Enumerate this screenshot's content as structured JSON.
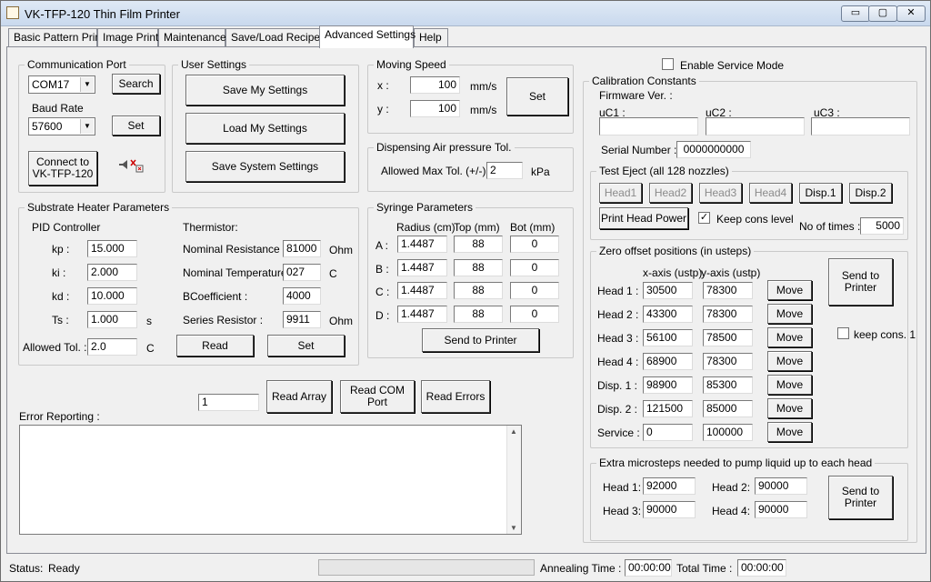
{
  "window": {
    "title": "VK-TFP-120 Thin Film Printer",
    "minimize": "▭",
    "maximize": "▢",
    "close": "✕"
  },
  "tabs": [
    "Basic Pattern Print",
    "Image Print",
    "Maintenance",
    "Save/Load Recipe",
    "Advanced Settings",
    "Help"
  ],
  "comm": {
    "title": "Communication Port",
    "port": "COM17",
    "search": "Search",
    "baud_label": "Baud Rate",
    "baud": "57600",
    "set": "Set",
    "connect": "Connect to VK-TFP-120"
  },
  "user": {
    "title": "User Settings",
    "save_my": "Save My Settings",
    "load_my": "Load My Settings",
    "save_system": "Save System Settings"
  },
  "speed": {
    "title": "Moving Speed",
    "x_label": "x :",
    "x": "100",
    "y_label": "y :",
    "y": "100",
    "unit": "mm/s",
    "set": "Set"
  },
  "air": {
    "title": "Dispensing Air pressure Tol.",
    "label": "Allowed Max Tol. (+/-) :",
    "value": "2",
    "unit": "kPa"
  },
  "heater": {
    "title": "Substrate Heater Parameters",
    "pid": "PID Controller",
    "kp_l": "kp :",
    "kp": "15.000",
    "ki_l": "ki :",
    "ki": "2.000",
    "kd_l": "kd :",
    "kd": "10.000",
    "ts_l": "Ts :",
    "ts": "1.000",
    "ts_u": "s",
    "therm": "Thermistor:",
    "nr_l": "Nominal Resistance :",
    "nr": "81000",
    "nr_u": "Ohm",
    "nt_l": "Nominal Temperature :",
    "nt": "027",
    "nt_u": "C",
    "bc_l": "BCoefficient :",
    "bc": "4000",
    "sr_l": "Series Resistor :",
    "sr": "9911",
    "sr_u": "Ohm",
    "tol_l": "Allowed Tol. :",
    "tol": "2.0",
    "tol_u": "C",
    "read": "Read",
    "set": "Set"
  },
  "syringe": {
    "title": "Syringe Parameters",
    "h_radius": "Radius (cm)",
    "h_top": "Top (mm)",
    "h_bot": "Bot (mm)",
    "rows": [
      {
        "l": "A :",
        "r": "1.4487",
        "t": "88",
        "b": "0"
      },
      {
        "l": "B :",
        "r": "1.4487",
        "t": "88",
        "b": "0"
      },
      {
        "l": "C :",
        "r": "1.4487",
        "t": "88",
        "b": "0"
      },
      {
        "l": "D :",
        "r": "1.4487",
        "t": "88",
        "b": "0"
      }
    ],
    "send": "Send to Printer"
  },
  "misc": {
    "array_idx": "1",
    "read_array": "Read Array",
    "read_com": "Read COM Port",
    "read_errors": "Read Errors",
    "err_label": "Error Reporting :",
    "err_text": ""
  },
  "service": {
    "label": "Enable Service Mode"
  },
  "calib": {
    "title": "Calibration Constants",
    "fw": "Firmware Ver. :",
    "uc1": "uC1 :",
    "uc2": "uC2 :",
    "uc3": "uC3 :",
    "sn_l": "Serial Number :",
    "sn": "0000000000"
  },
  "eject": {
    "title": "Test Eject (all 128 nozzles)",
    "buttons": [
      "Head1",
      "Head2",
      "Head3",
      "Head4",
      "Disp.1",
      "Disp.2"
    ],
    "power": "Print Head Power",
    "keep": "Keep cons level",
    "keep_checked": "✓",
    "times_l": "No of times :",
    "times": "5000"
  },
  "zero": {
    "title": "Zero offset positions (in usteps)",
    "hx": "x-axis (ustp)",
    "hy": "y-axis (ustp)",
    "move": "Move",
    "rows": [
      {
        "l": "Head 1 :",
        "x": "30500",
        "y": "78300"
      },
      {
        "l": "Head 2 :",
        "x": "43300",
        "y": "78300"
      },
      {
        "l": "Head 3 :",
        "x": "56100",
        "y": "78500"
      },
      {
        "l": "Head 4 :",
        "x": "68900",
        "y": "78300"
      },
      {
        "l": "Disp. 1 :",
        "x": "98900",
        "y": "85300"
      },
      {
        "l": "Disp. 2 :",
        "x": "121500",
        "y": "85000"
      },
      {
        "l": "Service :",
        "x": "0",
        "y": "100000"
      }
    ],
    "send": "Send to Printer",
    "keep": "keep cons. 1"
  },
  "extra": {
    "title": "Extra microsteps needed to pump liquid up to each head",
    "h1_l": "Head 1:",
    "h1": "92000",
    "h2_l": "Head 2:",
    "h2": "90000",
    "h3_l": "Head 3:",
    "h3": "90000",
    "h4_l": "Head 4:",
    "h4": "90000",
    "send": "Send to Printer"
  },
  "status": {
    "label": "Status:",
    "value": "Ready",
    "anneal_l": "Annealing Time :",
    "anneal": "00:00:00",
    "total_l": "Total Time :",
    "total": "00:00:00"
  }
}
